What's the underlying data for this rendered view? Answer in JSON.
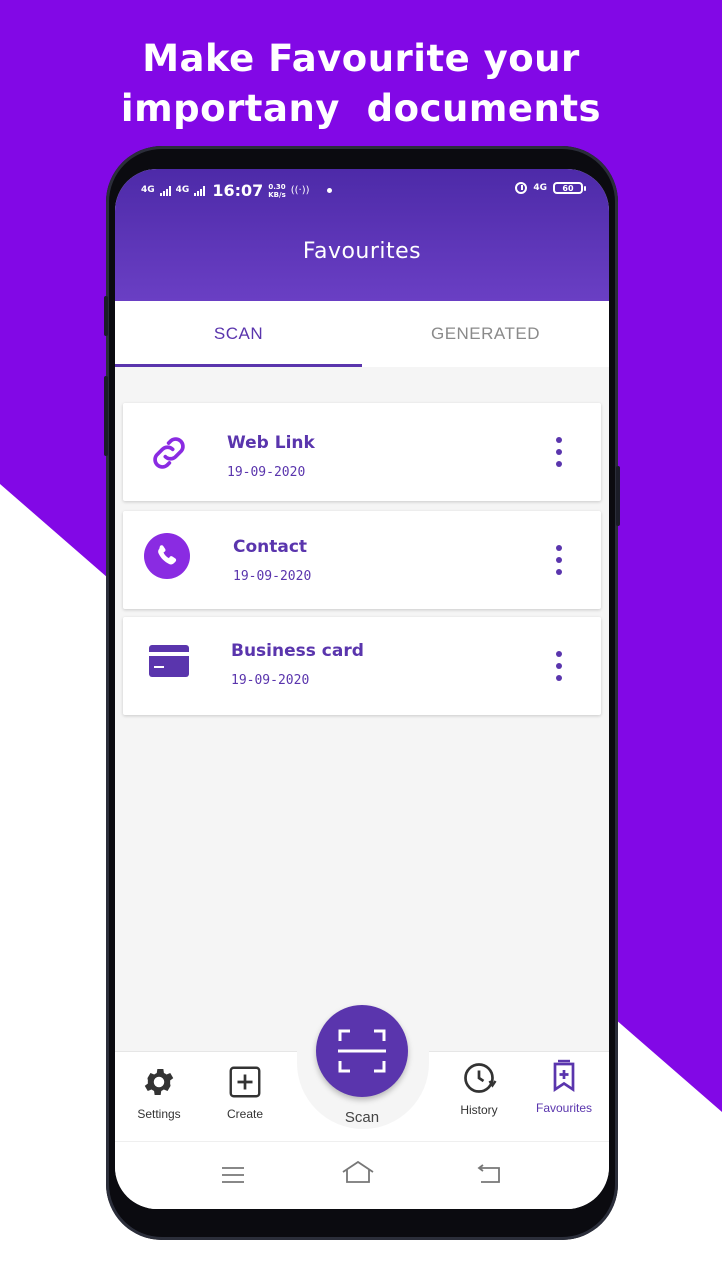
{
  "headline": {
    "line1": "Make Favourite your",
    "line2": "importany  documents"
  },
  "status_bar": {
    "network1": "4G",
    "network2": "4G",
    "time": "16:07",
    "speed_value": "0.30",
    "speed_unit": "KB/s",
    "network3": "4G",
    "battery": "60"
  },
  "appbar": {
    "title": "Favourites"
  },
  "tabs": [
    {
      "label": "SCAN",
      "selected": true
    },
    {
      "label": "GENERATED",
      "selected": false
    }
  ],
  "items": [
    {
      "title": "Web Link",
      "date": "19-09-2020",
      "icon": "link-icon"
    },
    {
      "title": "Contact",
      "date": "19-09-2020",
      "icon": "phone-icon"
    },
    {
      "title": "Business card",
      "date": "19-09-2020",
      "icon": "card-icon"
    }
  ],
  "bottom_nav": {
    "settings": "Settings",
    "create": "Create",
    "scan": "Scan",
    "history": "History",
    "favourites": "Favourites"
  },
  "colors": {
    "accent": "#5a35ad",
    "background": "#8208e6",
    "appbar": "#5b34b5"
  }
}
